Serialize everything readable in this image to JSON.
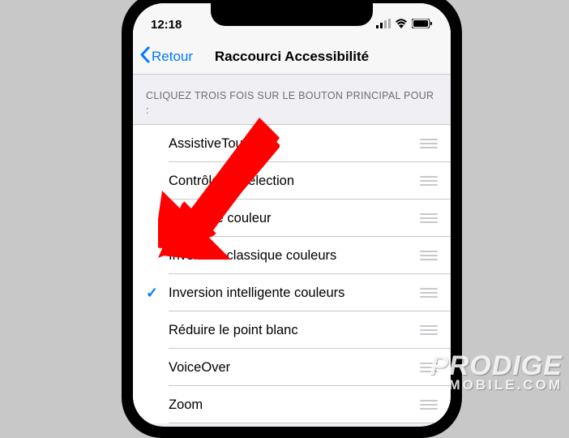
{
  "status": {
    "time": "12:18"
  },
  "nav": {
    "back_label": "Retour",
    "title": "Raccourci Accessibilité"
  },
  "section_header": "CLIQUEZ TROIS FOIS SUR LE BOUTON PRINCIPAL POUR :",
  "items": [
    {
      "label": "AssistiveTouch",
      "checked": false
    },
    {
      "label": "Contrôle de sélection",
      "checked": false
    },
    {
      "label": "Filtres de couleur",
      "checked": false
    },
    {
      "label": "Inversion classique couleurs",
      "checked": false
    },
    {
      "label": "Inversion intelligente couleurs",
      "checked": true
    },
    {
      "label": "Réduire le point blanc",
      "checked": false
    },
    {
      "label": "VoiceOver",
      "checked": false
    },
    {
      "label": "Zoom",
      "checked": false
    }
  ],
  "watermark": {
    "main": "PRODIGE",
    "sub": "MOBILE.COM"
  },
  "colors": {
    "accent": "#007aff",
    "arrow": "#ff0000"
  }
}
